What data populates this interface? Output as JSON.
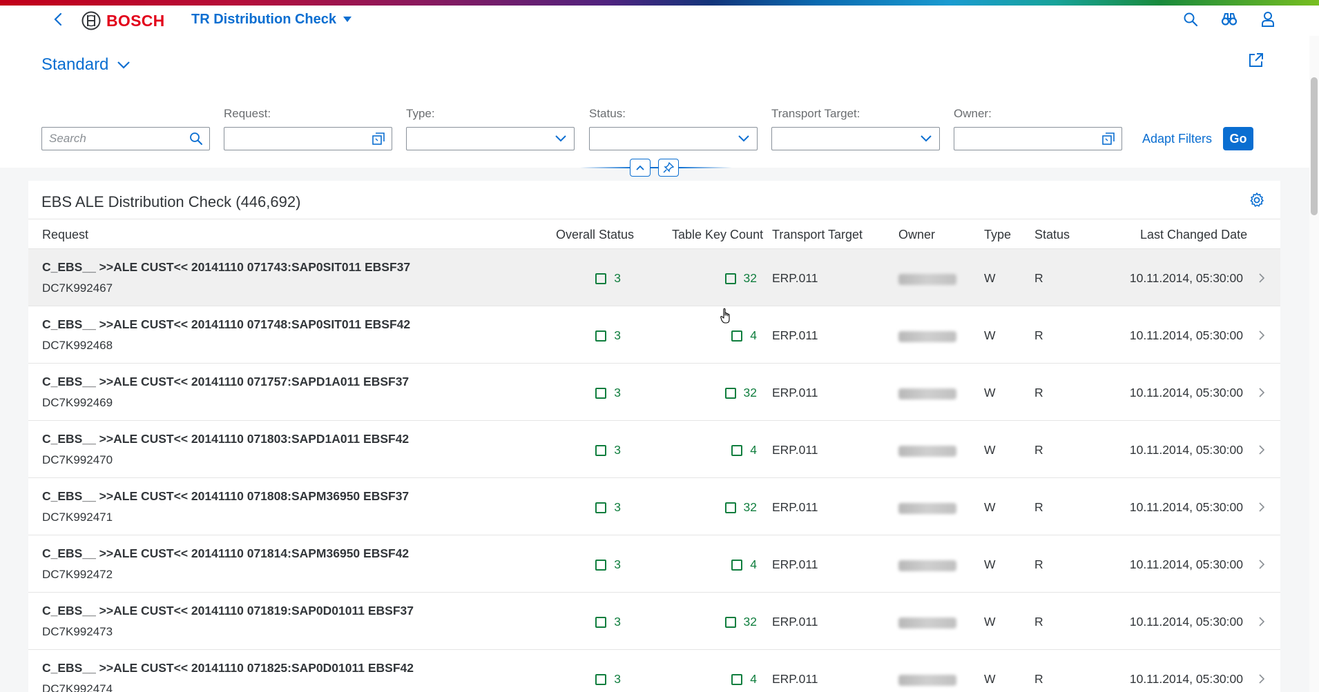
{
  "colors": {
    "accent": "#0a6ed1",
    "brand_red": "#e2001a",
    "positive": "#107e3e",
    "text": "#32363a"
  },
  "shell": {
    "brand": "BOSCH",
    "app_title": "TR Distribution Check",
    "icons": [
      "back-icon",
      "bosch-logo",
      "search-icon",
      "binoculars-icon",
      "user-icon"
    ]
  },
  "variant": {
    "label": "Standard"
  },
  "filters": {
    "search_placeholder": "Search",
    "request_label": "Request:",
    "type_label": "Type:",
    "status_label": "Status:",
    "transport_target_label": "Transport Target:",
    "owner_label": "Owner:",
    "adapt_filters": "Adapt Filters",
    "go": "Go"
  },
  "table": {
    "title": "EBS ALE Distribution Check (446,692)",
    "columns": {
      "request": "Request",
      "overall_status": "Overall Status",
      "table_key_count": "Table Key Count",
      "transport_target": "Transport Target",
      "owner": "Owner",
      "type": "Type",
      "status": "Status",
      "last_changed_date": "Last Changed Date"
    },
    "rows": [
      {
        "request": "C_EBS__ >>ALE CUST<< 20141110 071743:SAP0SIT011 EBSF37",
        "id": "DC7K992467",
        "overall_status": "3",
        "table_key_count": "32",
        "transport_target": "ERP.011",
        "type": "W",
        "status": "R",
        "last_changed": "10.11.2014, 05:30:00"
      },
      {
        "request": "C_EBS__ >>ALE CUST<< 20141110 071748:SAP0SIT011 EBSF42",
        "id": "DC7K992468",
        "overall_status": "3",
        "table_key_count": "4",
        "transport_target": "ERP.011",
        "type": "W",
        "status": "R",
        "last_changed": "10.11.2014, 05:30:00"
      },
      {
        "request": "C_EBS__ >>ALE CUST<< 20141110 071757:SAPD1A011 EBSF37",
        "id": "DC7K992469",
        "overall_status": "3",
        "table_key_count": "32",
        "transport_target": "ERP.011",
        "type": "W",
        "status": "R",
        "last_changed": "10.11.2014, 05:30:00"
      },
      {
        "request": "C_EBS__ >>ALE CUST<< 20141110 071803:SAPD1A011 EBSF42",
        "id": "DC7K992470",
        "overall_status": "3",
        "table_key_count": "4",
        "transport_target": "ERP.011",
        "type": "W",
        "status": "R",
        "last_changed": "10.11.2014, 05:30:00"
      },
      {
        "request": "C_EBS__ >>ALE CUST<< 20141110 071808:SAPM36950 EBSF37",
        "id": "DC7K992471",
        "overall_status": "3",
        "table_key_count": "32",
        "transport_target": "ERP.011",
        "type": "W",
        "status": "R",
        "last_changed": "10.11.2014, 05:30:00"
      },
      {
        "request": "C_EBS__ >>ALE CUST<< 20141110 071814:SAPM36950 EBSF42",
        "id": "DC7K992472",
        "overall_status": "3",
        "table_key_count": "4",
        "transport_target": "ERP.011",
        "type": "W",
        "status": "R",
        "last_changed": "10.11.2014, 05:30:00"
      },
      {
        "request": "C_EBS__ >>ALE CUST<< 20141110 071819:SAP0D01011 EBSF37",
        "id": "DC7K992473",
        "overall_status": "3",
        "table_key_count": "32",
        "transport_target": "ERP.011",
        "type": "W",
        "status": "R",
        "last_changed": "10.11.2014, 05:30:00"
      },
      {
        "request": "C_EBS__ >>ALE CUST<< 20141110 071825:SAP0D01011 EBSF42",
        "id": "DC7K992474",
        "overall_status": "3",
        "table_key_count": "4",
        "transport_target": "ERP.011",
        "type": "W",
        "status": "R",
        "last_changed": "10.11.2014, 05:30:00"
      }
    ]
  }
}
